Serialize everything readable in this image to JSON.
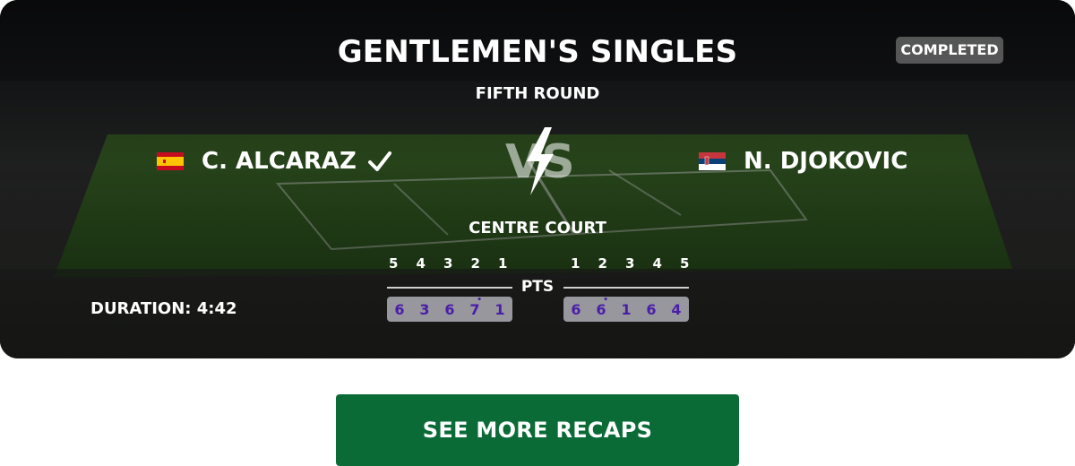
{
  "match": {
    "event": "GENTLEMEN'S SINGLES",
    "status": "COMPLETED",
    "round": "FIFTH ROUND",
    "court": "CENTRE COURT",
    "duration": "DURATION: 4:42",
    "pts_label": "PTS",
    "vs_label": "VS"
  },
  "players": {
    "left": {
      "name": "C. ALCARAZ",
      "country_flag": "spain",
      "winner": true
    },
    "right": {
      "name": "N. DJOKOVIC",
      "country_flag": "serbia",
      "winner": false
    }
  },
  "sets": {
    "left_headers": [
      "5",
      "4",
      "3",
      "2",
      "1"
    ],
    "right_headers": [
      "1",
      "2",
      "3",
      "4",
      "5"
    ],
    "left_scores": [
      "6",
      "3",
      "6",
      "7",
      "1"
    ],
    "right_scores": [
      "6",
      "6",
      "1",
      "6",
      "4"
    ]
  },
  "actions": {
    "see_more": "SEE MORE RECAPS"
  },
  "colors": {
    "button_green": "#0b6b37",
    "score_text": "#4a1fa8"
  }
}
